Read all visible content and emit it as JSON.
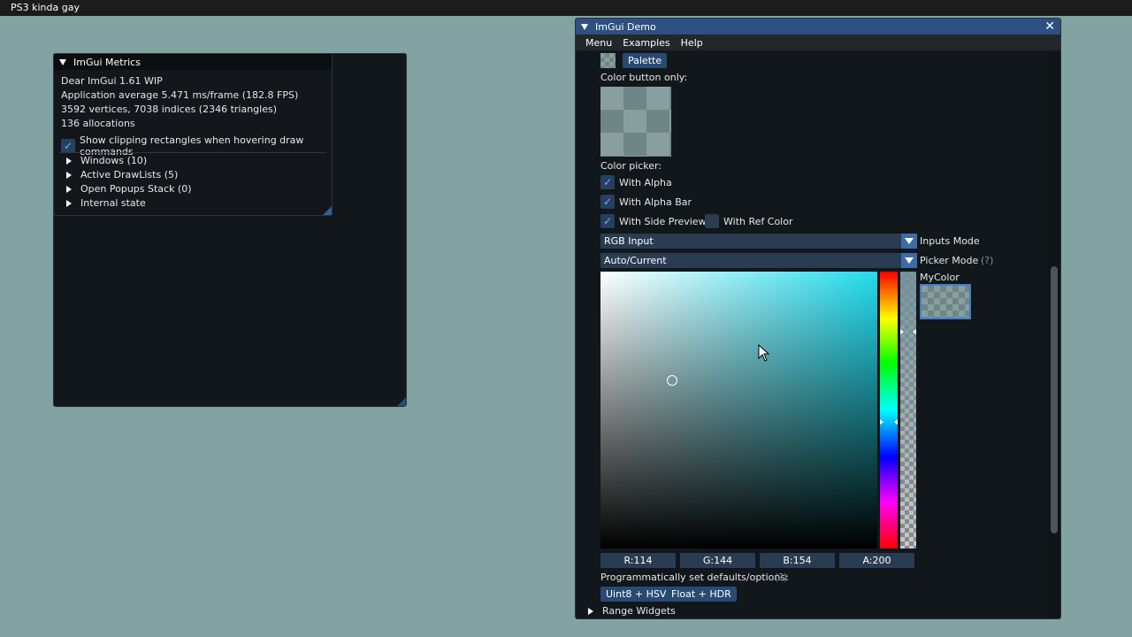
{
  "os_title": "PS3 kinda gay",
  "metrics": {
    "title": "ImGui Metrics",
    "version": "Dear ImGui 1.61 WIP",
    "avg": "Application average 5.471 ms/frame (182.8 FPS)",
    "vertices": "3592 vertices, 7038 indices (2346 triangles)",
    "allocations": "136 allocations",
    "clip_checkbox_label": "Show clipping rectangles when hovering draw commands",
    "tree": [
      "Windows (10)",
      "Active DrawLists (5)",
      "Open Popups Stack (0)",
      "Internal state"
    ]
  },
  "demo": {
    "title": "ImGui Demo",
    "menu": [
      "Menu",
      "Examples",
      "Help"
    ],
    "palette_button": "Palette",
    "color_button_only": "Color button only:",
    "color_picker": "Color picker:",
    "with_alpha": "With Alpha",
    "with_alpha_bar": "With Alpha Bar",
    "with_side_preview": "With Side Preview",
    "with_ref_color": "With Ref Color",
    "inputs_combo": "RGB Input",
    "inputs_label": "Inputs Mode",
    "picker_combo": "Auto/Current",
    "picker_label": "Picker Mode",
    "help_marker": "(?)",
    "mycolor_label": "MyColor",
    "r": "R:114",
    "g": "G:144",
    "b": "B:154",
    "a": "A:200",
    "prog_label": "Programmatically set defaults/options:",
    "btn_uint8": "Uint8 + HSV",
    "btn_float": "Float + HDR",
    "range_widgets": "Range Widgets"
  },
  "colors": {
    "background": "#82a3a2",
    "title_active": "#2c5082",
    "button": "#294a72",
    "check": "#6fb2ff"
  }
}
